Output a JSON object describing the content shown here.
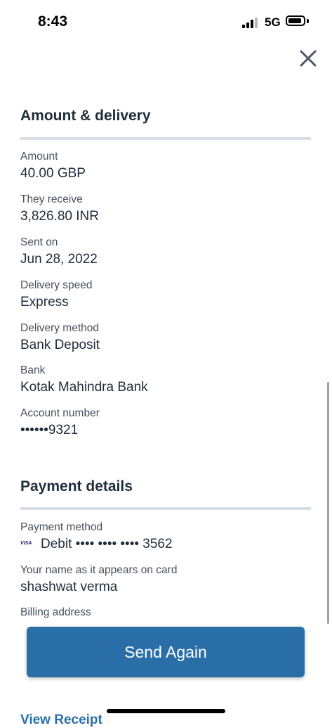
{
  "status_bar": {
    "time": "8:43",
    "network": "5G"
  },
  "amount_delivery": {
    "title": "Amount & delivery",
    "fields": [
      {
        "label": "Amount",
        "value": "40.00 GBP"
      },
      {
        "label": "They receive",
        "value": "3,826.80 INR"
      },
      {
        "label": "Sent on",
        "value": "Jun 28, 2022"
      },
      {
        "label": "Delivery speed",
        "value": "Express"
      },
      {
        "label": "Delivery method",
        "value": "Bank Deposit"
      },
      {
        "label": "Bank",
        "value": "Kotak Mahindra Bank"
      },
      {
        "label": "Account number",
        "value": "••••••9321"
      }
    ]
  },
  "payment_details": {
    "title": "Payment details",
    "payment_method_label": "Payment method",
    "card_brand": "VISA",
    "payment_method_value": "Debit •••• •••• •••• 3562",
    "name_label": "Your name as it appears on card",
    "name_value": "shashwat verma",
    "billing_label": "Billing address"
  },
  "actions": {
    "send_again": "Send Again",
    "view_receipt": "View Receipt"
  },
  "colors": {
    "primary": "#2a6ea8",
    "divider": "#d8dee5",
    "text": "#1f2d3a"
  },
  "icons": {
    "close": "close-icon"
  }
}
